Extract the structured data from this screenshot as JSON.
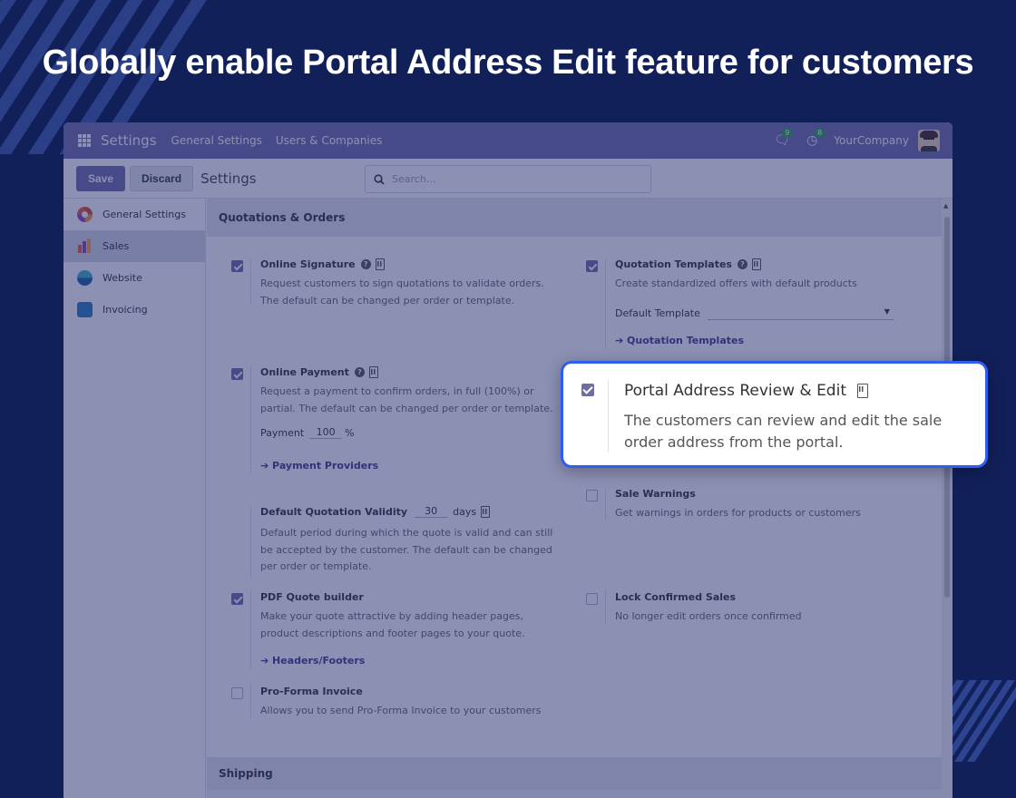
{
  "headline": "Globally enable Portal Address Edit feature for customers",
  "topbar": {
    "app_title": "Settings",
    "nav": [
      "General Settings",
      "Users & Companies"
    ],
    "messages_count": "9",
    "activities_count": "8",
    "company": "YourCompany"
  },
  "controlbar": {
    "save": "Save",
    "discard": "Discard",
    "breadcrumb": "Settings",
    "search_placeholder": "Search..."
  },
  "sidebar": {
    "items": [
      {
        "label": "General Settings",
        "icon": "odoo-logo-icon"
      },
      {
        "label": "Sales",
        "icon": "sales-chart-icon",
        "active": true
      },
      {
        "label": "Website",
        "icon": "website-globe-icon"
      },
      {
        "label": "Invoicing",
        "icon": "invoicing-icon"
      }
    ]
  },
  "sections": {
    "quotations": "Quotations & Orders",
    "shipping": "Shipping"
  },
  "settings": {
    "online_signature": {
      "title": "Online Signature",
      "desc": "Request customers to sign quotations to validate orders. The default can be changed per order or template.",
      "checked": true
    },
    "quotation_templates": {
      "title": "Quotation Templates",
      "desc": "Create standardized offers with default products",
      "checked": true,
      "field_label": "Default Template",
      "link": "Quotation Templates"
    },
    "online_payment": {
      "title": "Online Payment",
      "desc": "Request a payment to confirm orders, in full (100%) or partial. The default can be changed per order or template.",
      "checked": true,
      "field_label": "Payment",
      "field_value": "100",
      "field_unit": "%",
      "link": "Payment Providers"
    },
    "quotation_validity": {
      "title_prefix": "Default Quotation Validity",
      "value": "30",
      "unit": "days",
      "desc": "Default period during which the quote is valid and can still be accepted by the customer. The default can be changed per order or template."
    },
    "sale_warnings": {
      "title": "Sale Warnings",
      "desc": "Get warnings in orders for products or customers",
      "checked": false
    },
    "pdf_quote_builder": {
      "title": "PDF Quote builder",
      "desc": "Make your quote attractive by adding header pages, product descriptions and footer pages to your quote.",
      "checked": true,
      "link": "Headers/Footers"
    },
    "lock_confirmed": {
      "title": "Lock Confirmed Sales",
      "desc": "No longer edit orders once confirmed",
      "checked": false
    },
    "pro_forma": {
      "title": "Pro-Forma Invoice",
      "desc": "Allows you to send Pro-Forma Invoice to your customers",
      "checked": false
    }
  },
  "callout": {
    "title": "Portal Address Review & Edit",
    "desc": "The customers can review and edit the sale order address from the portal.",
    "checked": true
  },
  "colors": {
    "background": "#12205a",
    "primary": "#6e6ea7",
    "callout_border": "#2d5df2"
  }
}
